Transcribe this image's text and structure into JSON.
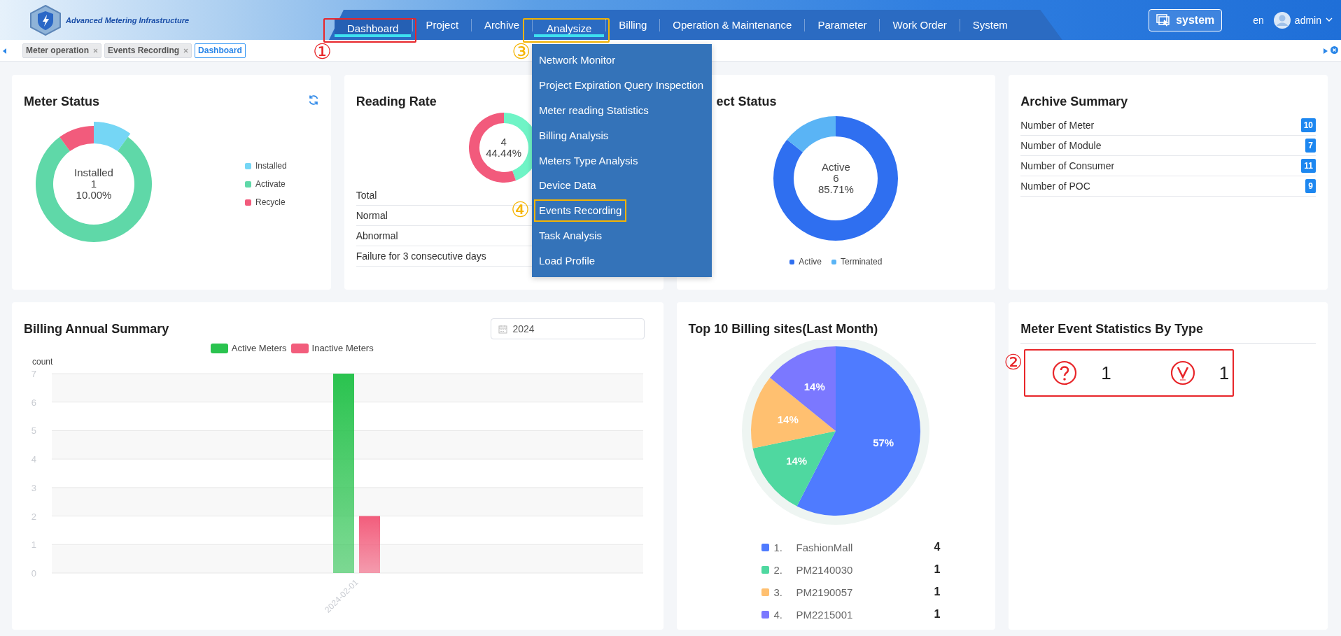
{
  "header": {
    "app_title": "Advanced Metering Infrastructure",
    "nav": [
      {
        "label": "Dashboard",
        "selected": true,
        "expanded": false,
        "annotation": {
          "mark": "①",
          "color": "#e8262a"
        }
      },
      {
        "label": "Project",
        "selected": false,
        "expanded": false
      },
      {
        "label": "Archive",
        "selected": false,
        "expanded": false
      },
      {
        "label": "Analysize",
        "selected": false,
        "expanded": true,
        "annotation": {
          "mark": "③",
          "color": "#f5b400"
        }
      },
      {
        "label": "Billing",
        "selected": false,
        "expanded": false
      },
      {
        "label": "Operation & Maintenance",
        "selected": false,
        "expanded": false
      },
      {
        "label": "Parameter",
        "selected": false,
        "expanded": false
      },
      {
        "label": "Work Order",
        "selected": false,
        "expanded": false
      },
      {
        "label": "System",
        "selected": false,
        "expanded": false
      }
    ],
    "system_button": "system",
    "language": "en",
    "user": "admin"
  },
  "analysize_menu": [
    {
      "label": "Network Monitor"
    },
    {
      "label": "Project Expiration Query Inspection"
    },
    {
      "label": "Meter reading Statistics"
    },
    {
      "label": "Billing Analysis"
    },
    {
      "label": "Meters Type Analysis"
    },
    {
      "label": "Device Data"
    },
    {
      "label": "Events Recording",
      "annotation": {
        "mark": "④",
        "color": "#f5b400"
      }
    },
    {
      "label": "Task Analysis"
    },
    {
      "label": "Load Profile"
    }
  ],
  "tags": [
    {
      "label": "Meter operation",
      "selected": false
    },
    {
      "label": "Events Recording",
      "selected": false
    },
    {
      "label": "Dashboard",
      "selected": true
    }
  ],
  "meter_status": {
    "title": "Meter Status",
    "center": [
      "Installed",
      "1",
      "10.00%"
    ],
    "legend": [
      {
        "label": "Installed",
        "color": "#75d6f5"
      },
      {
        "label": "Activate",
        "color": "#5fd8a8"
      },
      {
        "label": "Recycle",
        "color": "#f25b7c"
      }
    ],
    "chart_data": {
      "type": "donut",
      "values": [
        10,
        80,
        10
      ]
    }
  },
  "reading_rate": {
    "title": "Reading Rate",
    "center": [
      "4",
      "44.44%"
    ],
    "chart_data": {
      "type": "donut",
      "values": [
        44.44,
        55.56
      ]
    },
    "rows": [
      "Total",
      "Normal",
      "Abnormal",
      "Failure for 3 consecutive days"
    ]
  },
  "project_status": {
    "title": "ect Status",
    "center": [
      "Active",
      "6",
      "85.71%"
    ],
    "legend": [
      {
        "label": "Active",
        "color": "#2f6ff0"
      },
      {
        "label": "Terminated",
        "color": "#5ab4f5"
      }
    ],
    "chart_data": {
      "type": "donut",
      "values": [
        85.71,
        14.29
      ]
    }
  },
  "archive_summary": {
    "title": "Archive Summary",
    "rows": [
      {
        "label": "Number of Meter",
        "count": "10"
      },
      {
        "label": "Number of Module",
        "count": "7"
      },
      {
        "label": "Number of Consumer",
        "count": "11"
      },
      {
        "label": "Number of POC",
        "count": "9"
      }
    ]
  },
  "billing_summary": {
    "title": "Billing Annual Summary",
    "date_field": "2024",
    "chart_data": {
      "type": "bar",
      "ylabel": "count",
      "categories": [
        "2024-02-01"
      ],
      "series": [
        {
          "name": "Active Meters",
          "color": "#2ac34f",
          "values": [
            7
          ]
        },
        {
          "name": "Inactive Meters",
          "color": "#f25d7c",
          "values": [
            2
          ]
        }
      ],
      "ylim": [
        0,
        7
      ],
      "yticks": [
        0,
        1,
        2,
        3,
        4,
        5,
        6,
        7
      ],
      "grid": true
    }
  },
  "top_billing_sites": {
    "title": "Top 10 Billing sites(Last Month)",
    "chart_data": {
      "type": "pie",
      "values": [
        57,
        14,
        14,
        14
      ],
      "value_labels": [
        "57%",
        "14%",
        "14%",
        "14%"
      ]
    },
    "legend": [
      {
        "rank": "1.",
        "name": "FashionMall",
        "count": "4",
        "color": "#4f7bff"
      },
      {
        "rank": "2.",
        "name": "PM2140030",
        "count": "1",
        "color": "#4fd8a0"
      },
      {
        "rank": "3.",
        "name": "PM2190057",
        "count": "1",
        "color": "#ffc070"
      },
      {
        "rank": "4.",
        "name": "PM2215001",
        "count": "1",
        "color": "#7b78ff"
      }
    ]
  },
  "event_statistics": {
    "title": "Meter Event Statistics By Type",
    "annotation": {
      "mark": "②",
      "color": "#e8262a"
    },
    "items": [
      {
        "kind": "question",
        "count": "1"
      },
      {
        "kind": "voltage",
        "count": "1"
      }
    ]
  }
}
